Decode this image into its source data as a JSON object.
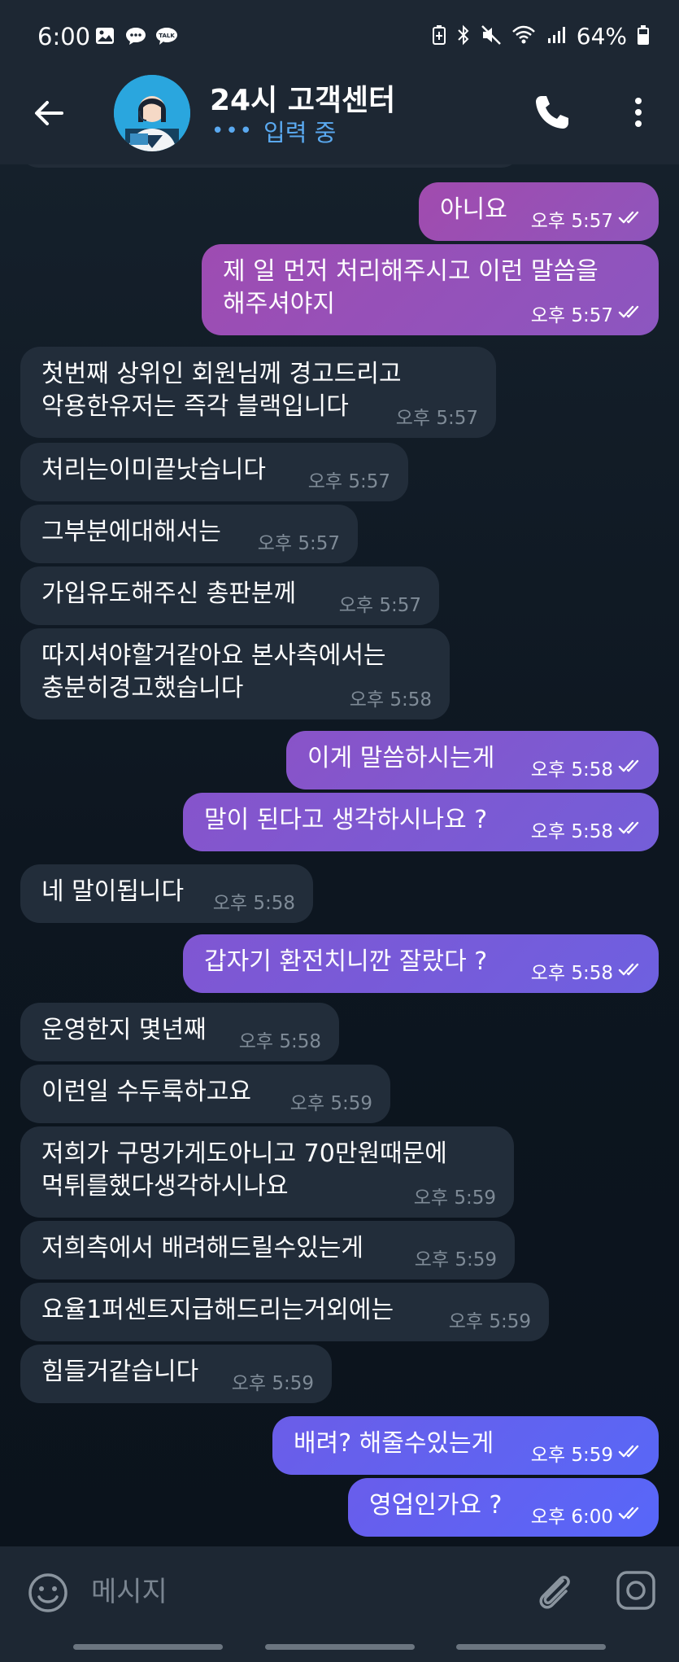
{
  "status_bar": {
    "time": "6:00",
    "left_icons": [
      "image-icon",
      "chat-bubble-icon",
      "kakaotalk-icon"
    ],
    "kakao_label": "TALK",
    "right_icons": [
      "battery-saver-icon",
      "bluetooth-icon",
      "mute-icon",
      "wifi-icon",
      "signal-icon"
    ],
    "battery": "64%"
  },
  "header": {
    "title": "24시 고객센터",
    "status": "입력 중",
    "typing_dots": "•••"
  },
  "composer": {
    "placeholder": "메시지"
  },
  "messages": [
    {
      "dir": "out",
      "text": "아니요",
      "time": "오후 5:57",
      "read": true
    },
    {
      "dir": "out",
      "text": "제 일 먼저 처리해주시고 이런 말씀을\n해주셔야지",
      "time": "오후 5:57",
      "read": true
    },
    {
      "dir": "in",
      "text": "첫번째 상위인 회원님께 경고드리고\n악용한유저는 즉각 블랙입니다",
      "time": "오후 5:57"
    },
    {
      "dir": "in",
      "text": "처리는이미끝낫습니다",
      "time": "오후 5:57"
    },
    {
      "dir": "in",
      "text": "그부분에대해서는",
      "time": "오후 5:57"
    },
    {
      "dir": "in",
      "text": "가입유도해주신 총판분께",
      "time": "오후 5:57"
    },
    {
      "dir": "in",
      "text": "따지셔야할거같아요 본사측에서는\n충분히경고했습니다",
      "time": "오후 5:58"
    },
    {
      "dir": "out",
      "text": "이게 말씀하시는게",
      "time": "오후 5:58",
      "read": true
    },
    {
      "dir": "out",
      "text": "말이 된다고 생각하시나요 ?",
      "time": "오후 5:58",
      "read": true
    },
    {
      "dir": "in",
      "text": "네 말이됩니다",
      "time": "오후 5:58"
    },
    {
      "dir": "out",
      "text": "갑자기 환전치니깐 잘랐다 ?",
      "time": "오후 5:58",
      "read": true
    },
    {
      "dir": "in",
      "text": "운영한지 몇년째",
      "time": "오후 5:58"
    },
    {
      "dir": "in",
      "text": "이런일 수두룩하고요",
      "time": "오후 5:59"
    },
    {
      "dir": "in",
      "text": "저희가 구멍가게도아니고 70만원때문에\n먹튀를했다생각하시나요",
      "time": "오후 5:59"
    },
    {
      "dir": "in",
      "text": "저희측에서 배려해드릴수있는게",
      "time": "오후 5:59"
    },
    {
      "dir": "in",
      "text": "요율1퍼센트지급해드리는거외에는",
      "time": "오후 5:59"
    },
    {
      "dir": "in",
      "text": "힘들거같습니다",
      "time": "오후 5:59"
    },
    {
      "dir": "out",
      "text": "배려? 해줄수있는게",
      "time": "오후 5:59",
      "read": true
    },
    {
      "dir": "out",
      "text": "영업인가요 ?",
      "time": "오후 6:00",
      "read": true
    }
  ]
}
